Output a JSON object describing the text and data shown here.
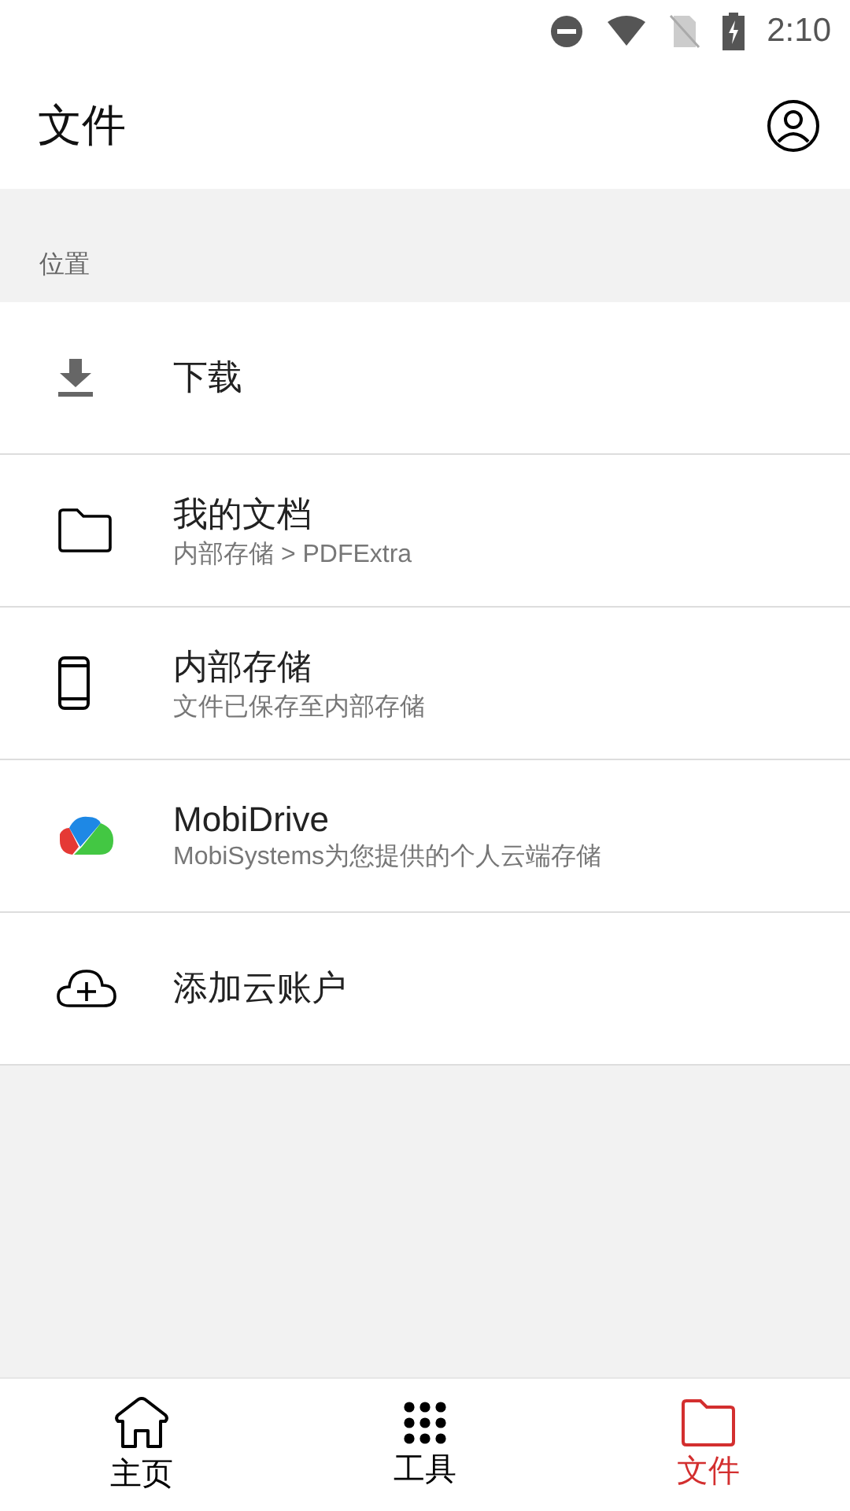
{
  "status_bar": {
    "time": "2:10"
  },
  "app_bar": {
    "title": "文件"
  },
  "section": {
    "title": "位置"
  },
  "locations": [
    {
      "kind": "download",
      "title": "下载"
    },
    {
      "kind": "folder",
      "title": "我的文档",
      "subtitle": "内部存储 > PDFExtra"
    },
    {
      "kind": "phone",
      "title": "内部存储",
      "subtitle": "文件已保存至内部存储"
    },
    {
      "kind": "cloud-logo",
      "title": "MobiDrive",
      "subtitle": "MobiSystems为您提供的个人云端存储"
    },
    {
      "kind": "add-cloud",
      "title": "添加云账户"
    }
  ],
  "bottom_nav": [
    {
      "kind": "home",
      "label": "主页",
      "selected": false
    },
    {
      "kind": "tools",
      "label": "工具",
      "selected": false
    },
    {
      "kind": "files",
      "label": "文件",
      "selected": true
    }
  ]
}
